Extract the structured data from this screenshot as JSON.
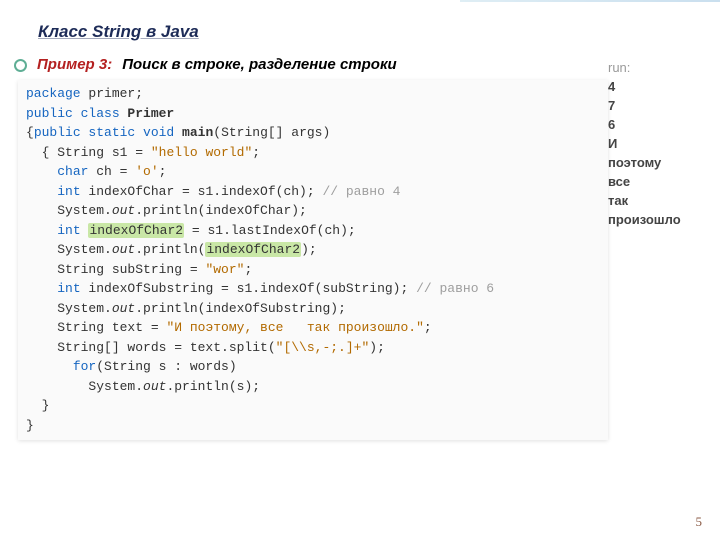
{
  "slide": {
    "title": "Класс  String в Java",
    "example_label": "Пример 3:",
    "example_text": "Поиск в строке, разделение строки",
    "page_number": "5"
  },
  "code": {
    "pkg_kw": "package",
    "pkg_name": " primer;",
    "pub": "public",
    "cls": " class ",
    "clsname": "Primer",
    "sig_open": "{",
    "static_kw": "public static void ",
    "main": "main",
    "sig_params": "(String[] args)",
    "l1_brace": "  { ",
    "l1_a": "String s1 = ",
    "l1_str": "\"hello world\"",
    "l1_end": ";",
    "l2_a": "    ",
    "l2_kw": "char",
    "l2_b": " ch = ",
    "l2_str": "'o'",
    "l2_end": ";",
    "l3_a": "    ",
    "l3_kw": "int",
    "l3_b": " indexOfChar = s1.indexOf(ch); ",
    "l3_cm": "// равно 4",
    "l4_a": "    System.",
    "l4_out": "out",
    "l4_b": ".println(indexOfChar);",
    "l5_a": "    ",
    "l5_kw": "int",
    "l5_sp": " ",
    "l5_hl": "indexOfChar2",
    "l5_b": " = s1.lastIndexOf(ch);",
    "l6_a": "    System.",
    "l6_out": "out",
    "l6_b": ".println(",
    "l6_hl": "indexOfChar2",
    "l6_c": ");",
    "l7_a": "    String subString = ",
    "l7_str": "\"wor\"",
    "l7_end": ";",
    "l8_a": "    ",
    "l8_kw": "int",
    "l8_b": " indexOfSubstring = s1.indexOf(subString); ",
    "l8_cm": "// равно 6",
    "l9_a": "    System.",
    "l9_out": "out",
    "l9_b": ".println(indexOfSubstring);",
    "l10_a": "    String text = ",
    "l10_str": "\"И поэтому, все   так произошло.\"",
    "l10_end": ";",
    "l11_a": "    String[] words = text.split(",
    "l11_str": "\"[\\\\s,-;.]+\"",
    "l11_end": ");",
    "l12_a": "      ",
    "l12_kw": "for",
    "l12_b": "(String s : words)",
    "l13_a": "        System.",
    "l13_out": "out",
    "l13_b": ".println(s);",
    "l14": "  }",
    "l15": "}"
  },
  "output": {
    "header": "run:",
    "rows": [
      "4",
      "7",
      "6",
      "И",
      "поэтому",
      "все",
      "так",
      "произошло"
    ]
  }
}
